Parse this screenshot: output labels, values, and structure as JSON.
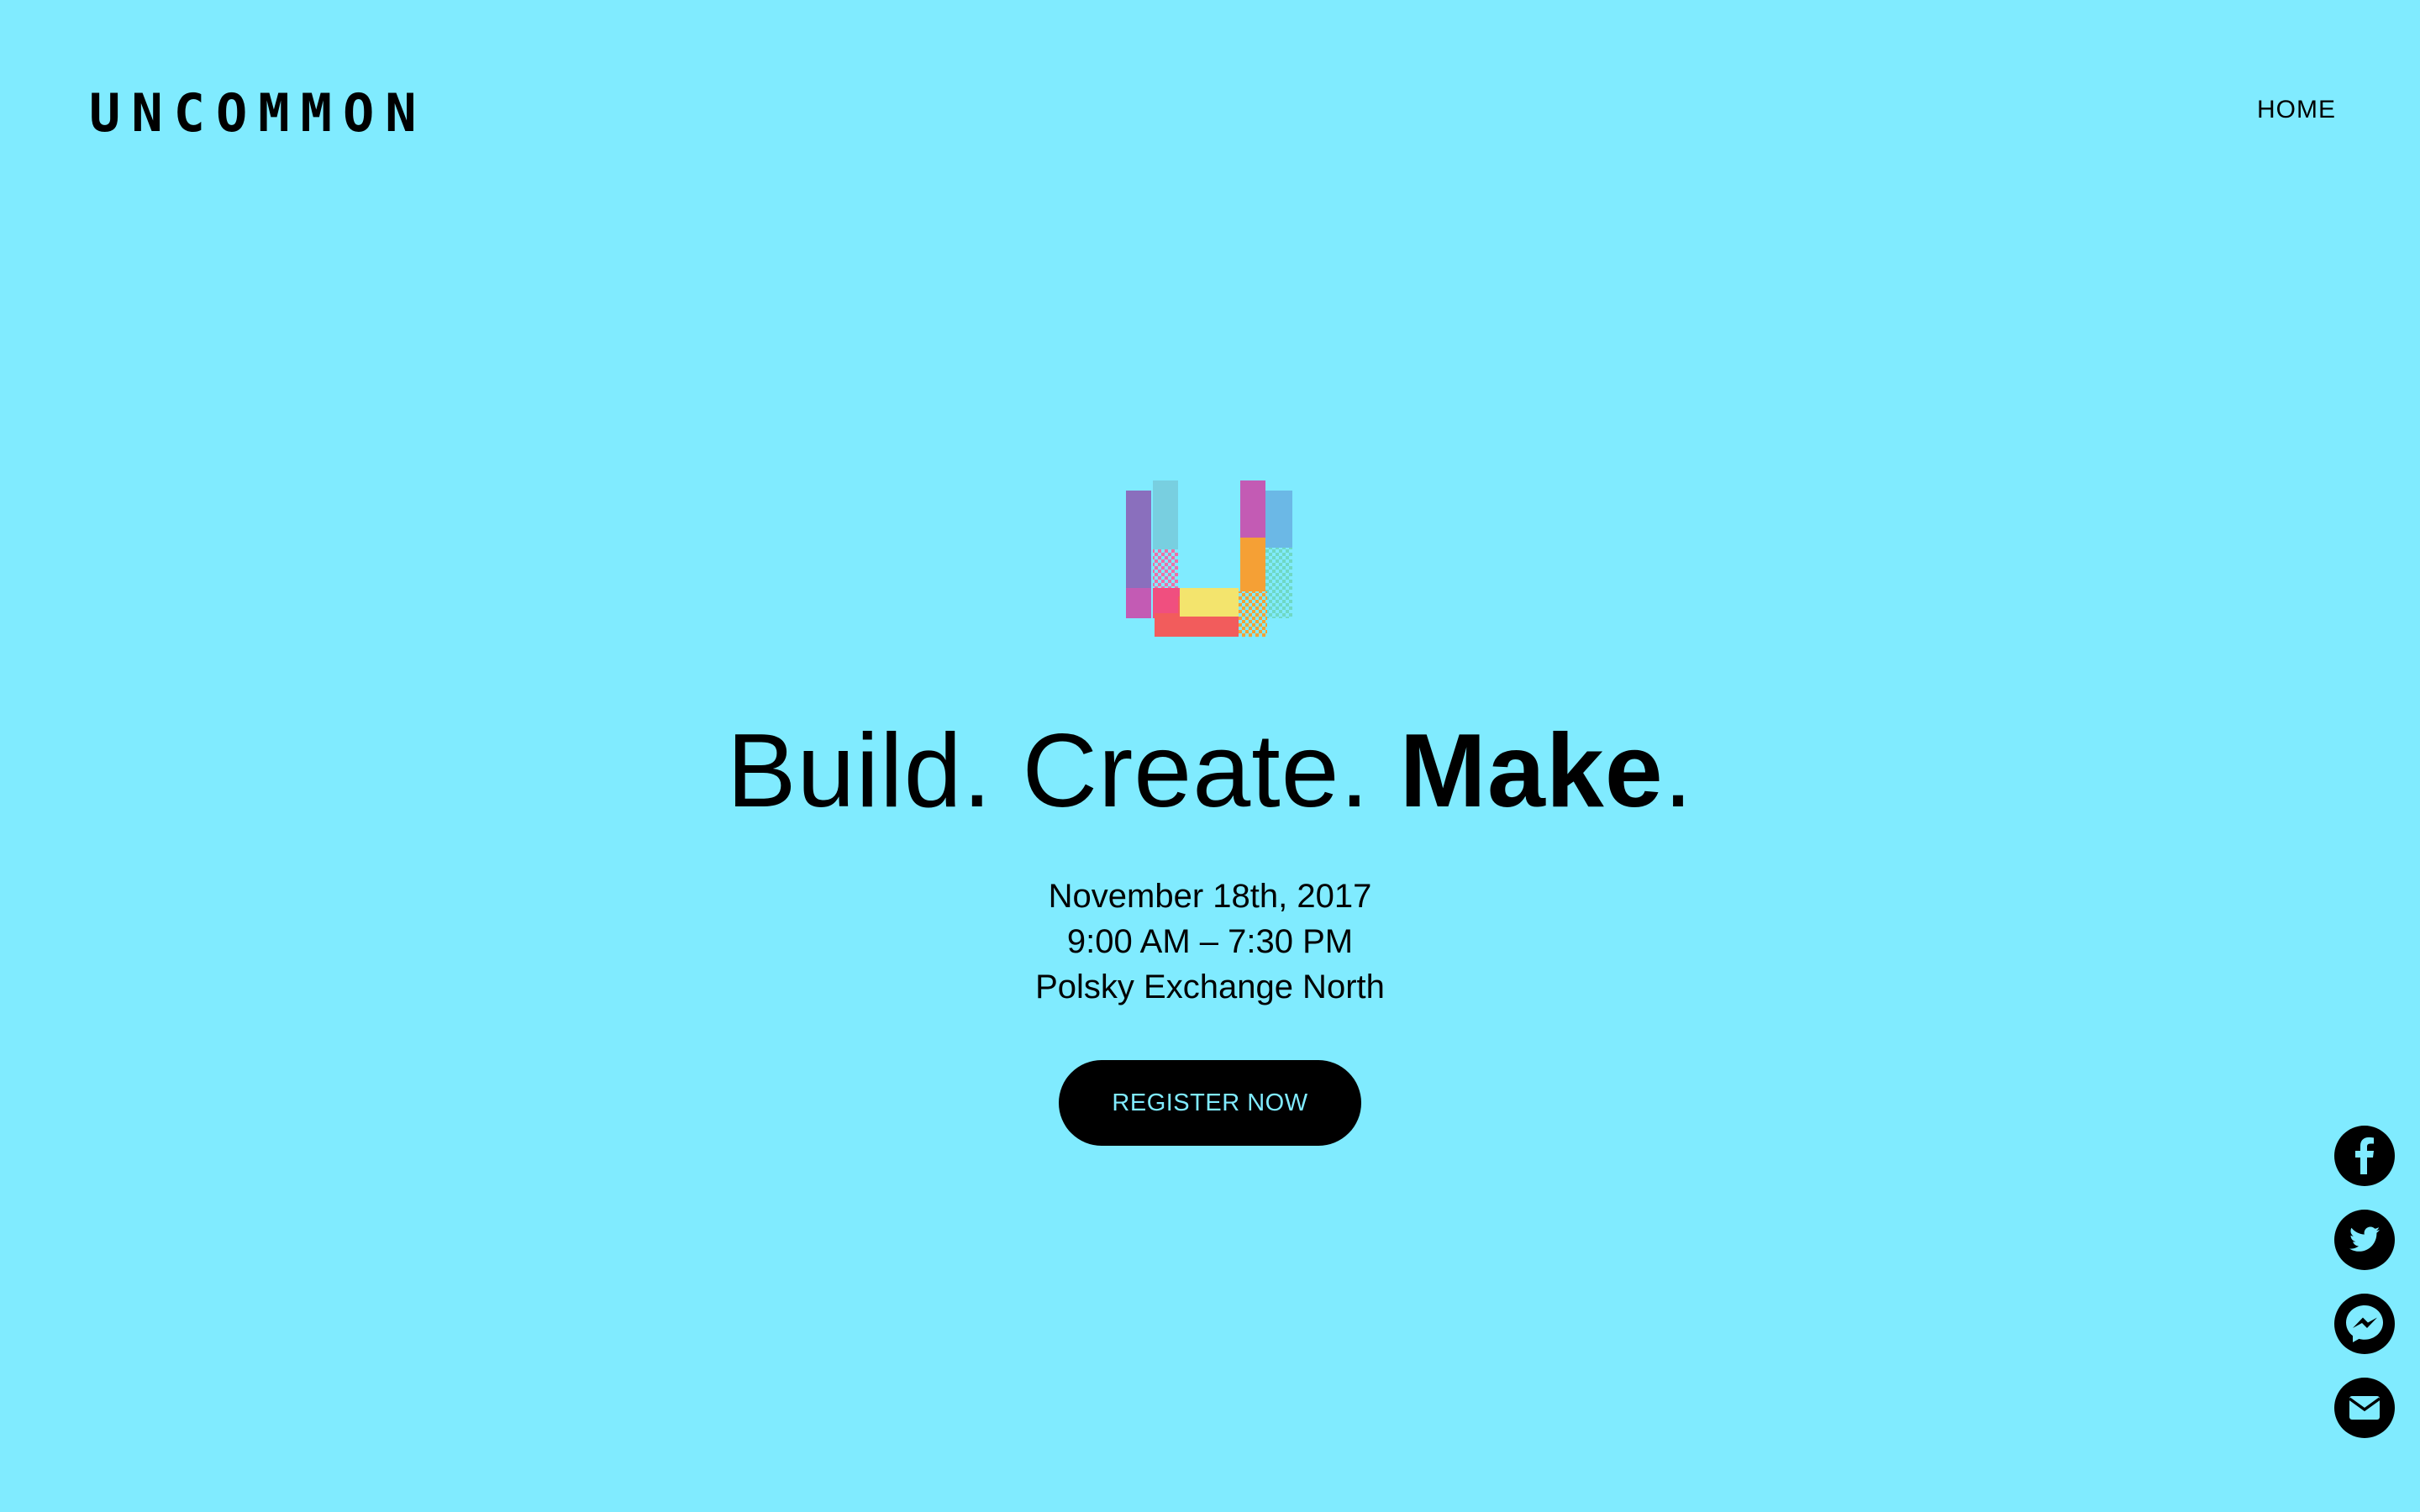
{
  "header": {
    "brand": "UNCOMMON",
    "nav": {
      "home_label": "HOME"
    }
  },
  "hero": {
    "headline": {
      "part1": "Build. Create. ",
      "part2": "Make",
      "part3": "."
    },
    "details": {
      "date": "November 18th, 2017",
      "time": "9:00 AM – 7:30 PM",
      "venue": "Polsky Exchange North"
    },
    "register_label": "REGISTER NOW"
  },
  "social": [
    {
      "icon": "facebook-icon"
    },
    {
      "icon": "twitter-icon"
    },
    {
      "icon": "messenger-icon"
    },
    {
      "icon": "email-icon"
    }
  ],
  "colors": {
    "background": "#80ebff",
    "text": "#000000",
    "button_text": "#80ebff"
  }
}
